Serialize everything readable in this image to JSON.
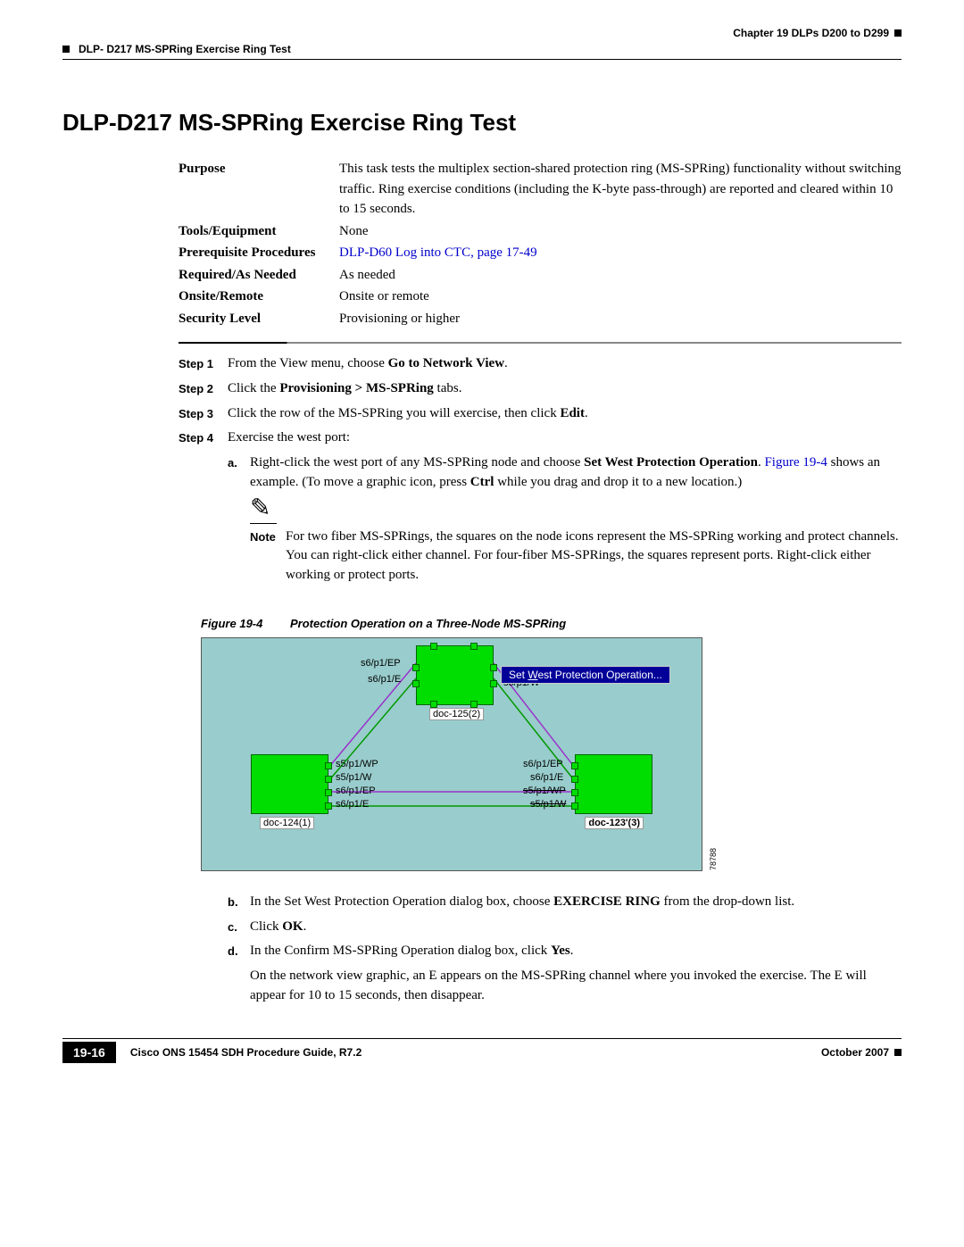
{
  "header": {
    "chapter": "Chapter 19 DLPs D200 to D299",
    "section": "DLP- D217 MS-SPRing Exercise Ring Test"
  },
  "title": "DLP-D217 MS-SPRing Exercise Ring Test",
  "info": {
    "purpose_label": "Purpose",
    "purpose_text": "This task tests the multiplex section-shared protection ring (MS-SPRing) functionality without switching traffic. Ring exercise conditions (including the K-byte pass-through) are reported and cleared within 10 to 15 seconds.",
    "tools_label": "Tools/Equipment",
    "tools_text": "None",
    "prereq_label": "Prerequisite Procedures",
    "prereq_link": "DLP-D60 Log into CTC, page 17-49",
    "required_label": "Required/As Needed",
    "required_text": "As needed",
    "onsite_label": "Onsite/Remote",
    "onsite_text": "Onsite or remote",
    "security_label": "Security Level",
    "security_text": "Provisioning or higher"
  },
  "steps": {
    "s1_label": "Step 1",
    "s1_pre": "From the View menu, choose ",
    "s1_bold": "Go to Network View",
    "s1_post": ".",
    "s2_label": "Step 2",
    "s2_pre": "Click the ",
    "s2_bold": "Provisioning > MS-SPRing",
    "s2_post": " tabs.",
    "s3_label": "Step 3",
    "s3_pre": "Click the row of the MS-SPRing you will exercise, then click ",
    "s3_bold": "Edit",
    "s3_post": ".",
    "s4_label": "Step 4",
    "s4_text": "Exercise the west port:",
    "a_label": "a.",
    "a_pre": "Right-click the west port of any MS-SPRing node and choose ",
    "a_bold": "Set West Protection Operation",
    "a_mid": ". ",
    "a_link": "Figure 19-4",
    "a_mid2": " shows an example. (To move a graphic icon, press ",
    "a_bold2": "Ctrl",
    "a_post": " while you drag and drop it to a new location.)",
    "note_label": "Note",
    "note_text": "For two fiber MS-SPRings, the squares on the node icons represent the MS-SPRing working and protect channels. You can right-click either channel. For four-fiber MS-SPRings, the squares represent ports. Right-click either working or protect ports.",
    "b_label": "b.",
    "b_pre": "In the Set West Protection Operation dialog box, choose ",
    "b_bold": "EXERCISE RING",
    "b_post": " from the drop-down list.",
    "c_label": "c.",
    "c_pre": "Click ",
    "c_bold": "OK",
    "c_post": ".",
    "d_label": "d.",
    "d_pre": "In the Confirm MS-SPRing Operation dialog box, click ",
    "d_bold": "Yes",
    "d_post": ".",
    "d_para": "On the network view graphic, an E appears on the MS-SPRing channel where you invoked the exercise. The E will appear for 10 to 15 seconds, then disappear."
  },
  "figure": {
    "num": "Figure 19-4",
    "caption": "Protection Operation on a Three-Node MS-SPRing",
    "id": "78788",
    "menu": "Set West Protection Operation...",
    "node_top": "doc-125(2)",
    "node_left": "doc-124(1)",
    "node_right": "doc-123'(3)",
    "ports": {
      "tl1": "s6/p1/EP",
      "tl2": "s6/p1/E",
      "tr1": "s5/p1/W",
      "ll1": "s5/p1/WP",
      "ll2": "s5/p1/W",
      "ll3": "s6/p1/EP",
      "ll4": "s6/p1/E",
      "rr1": "s6/p1/EP",
      "rr2": "s6/p1/E",
      "rr3": "s5/p1/WP",
      "rr4": "s5/p1/W"
    }
  },
  "footer": {
    "doc": "Cisco ONS 15454 SDH Procedure Guide, R7.2",
    "page": "19-16",
    "date": "October 2007"
  }
}
